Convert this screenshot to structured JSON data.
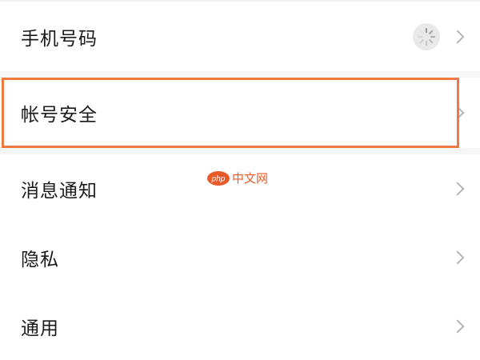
{
  "settings": {
    "items": [
      {
        "label": "手机号码",
        "has_spinner": true
      },
      {
        "label": "帐号安全",
        "highlighted": true
      },
      {
        "label": "消息通知"
      },
      {
        "label": "隐私"
      },
      {
        "label": "通用"
      }
    ]
  },
  "watermark": {
    "logo_text": "php",
    "text": "中文网"
  },
  "colors": {
    "highlight": "#ee7a43",
    "chevron": "#b5b5b5",
    "watermark": "#e85a2a"
  },
  "icons": {
    "chevron": "chevron-right-icon",
    "spinner": "loading-spinner-icon"
  }
}
